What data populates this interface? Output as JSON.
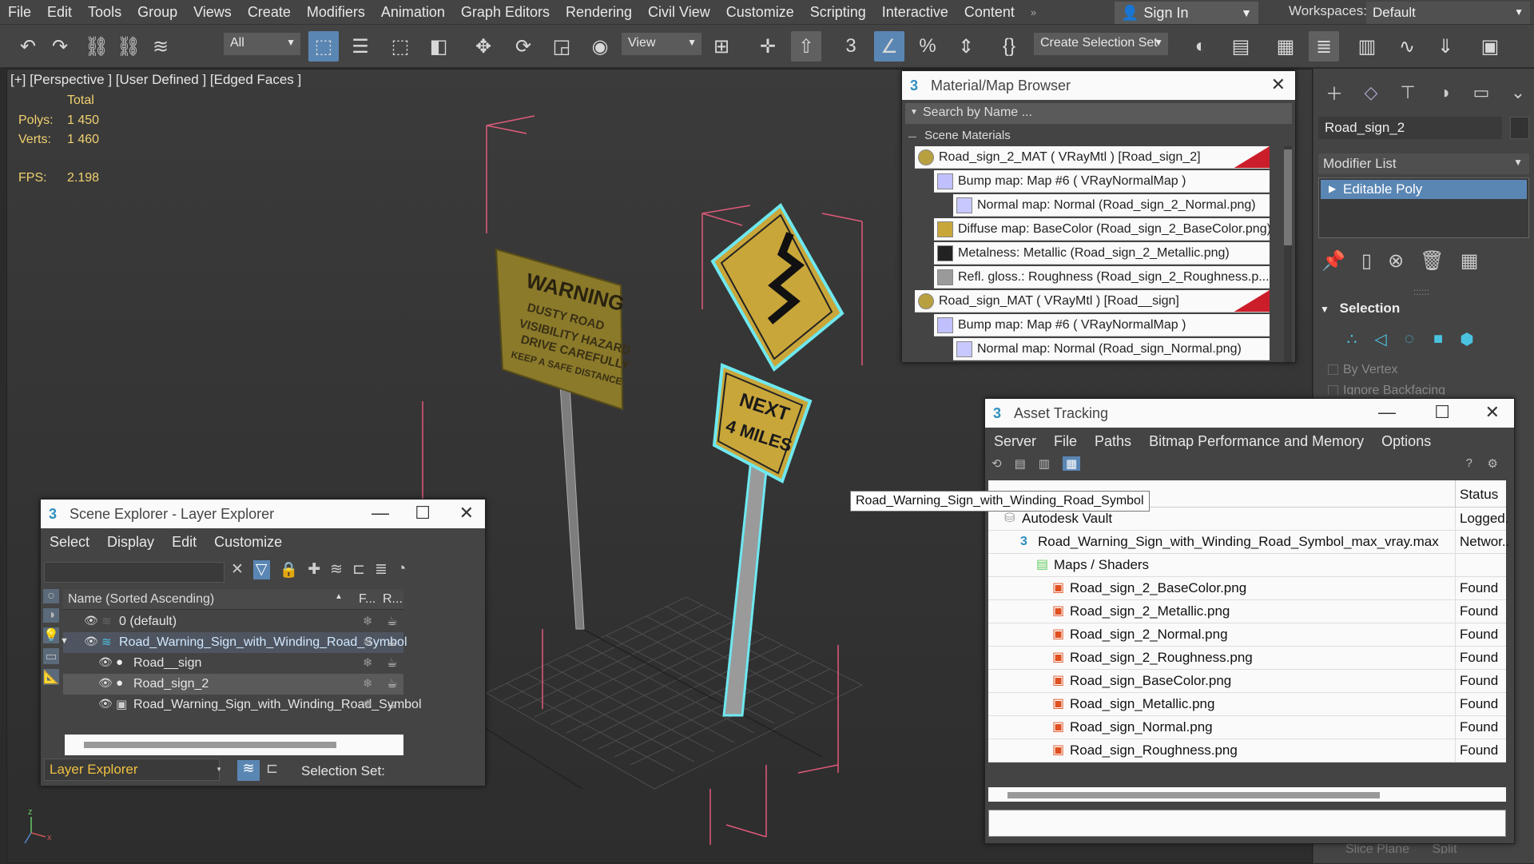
{
  "menu": [
    "File",
    "Edit",
    "Tools",
    "Group",
    "Views",
    "Create",
    "Modifiers",
    "Animation",
    "Graph Editors",
    "Rendering",
    "Civil View",
    "Customize",
    "Scripting",
    "Interactive",
    "Content"
  ],
  "signin": "Sign In",
  "workspaces_label": "Workspaces:",
  "workspace_value": "Default",
  "toolbar": {
    "filter_value": "All",
    "refcoord_value": "View",
    "selection_set": "Create Selection Set"
  },
  "viewport": {
    "label": "[+] [Perspective ] [User Defined ] [Edged Faces ]",
    "total_label": "Total",
    "polys_label": "Polys:",
    "polys_value": "1 450",
    "verts_label": "Verts:",
    "verts_value": "1 460",
    "fps_label": "FPS:",
    "fps_value": "2.198"
  },
  "command_panel": {
    "object_name": "Road_sign_2",
    "modifier_list": "Modifier List",
    "stack_item": "Editable Poly",
    "rollout": "Selection",
    "by_vertex": "By Vertex",
    "ignore_backfacing": "Ignore Backfacing",
    "slice_plane": "Slice Plane",
    "split": "Split"
  },
  "material_browser": {
    "title": "Material/Map Browser",
    "search_placeholder": "Search by Name ...",
    "section": "Scene Materials",
    "rows": [
      {
        "text": "Road_sign_2_MAT  ( VRayMtl )  [Road_sign_2]",
        "indent": 0,
        "swatch": "#b8a040",
        "red": true
      },
      {
        "text": "Bump map: Map #6  ( VRayNormalMap )",
        "indent": 1,
        "swatch": "#c0c0ff",
        "red": false
      },
      {
        "text": "Normal map: Normal (Road_sign_2_Normal.png)",
        "indent": 2,
        "swatch": "#c8c8ff",
        "red": false
      },
      {
        "text": "Diffuse map: BaseColor (Road_sign_2_BaseColor.png)",
        "indent": 1,
        "swatch": "#c9a63a",
        "red": false
      },
      {
        "text": "Metalness: Metallic (Road_sign_2_Metallic.png)",
        "indent": 1,
        "swatch": "#222222",
        "red": false
      },
      {
        "text": "Refl.  gloss.:  Roughness  (Road_sign_2_Roughness.p...",
        "indent": 1,
        "swatch": "#9a9a9a",
        "red": false
      },
      {
        "text": "Road_sign_MAT  ( VRayMtl )  [Road__sign]",
        "indent": 0,
        "swatch": "#b8a040",
        "red": true
      },
      {
        "text": "Bump map: Map #6  ( VRayNormalMap )",
        "indent": 1,
        "swatch": "#c0c0ff",
        "red": false
      },
      {
        "text": "Normal map: Normal (Road_sign_Normal.png)",
        "indent": 2,
        "swatch": "#c8c8ff",
        "red": false
      }
    ]
  },
  "asset_tracking": {
    "title": "Asset Tracking",
    "menu": [
      "Server",
      "File",
      "Paths",
      "Bitmap Performance and Memory",
      "Options"
    ],
    "tooltip": "Road_Warning_Sign_with_Winding_Road_Symbol",
    "status_header": "Status",
    "rows": [
      {
        "name": "Autodesk Vault",
        "status": "Logged.",
        "indent": 0,
        "icon": "vault"
      },
      {
        "name": "Road_Warning_Sign_with_Winding_Road_Symbol_max_vray.max",
        "status": "Networ..",
        "indent": 1,
        "icon": "max"
      },
      {
        "name": "Maps / Shaders",
        "status": "",
        "indent": 2,
        "icon": "folder"
      },
      {
        "name": "Road_sign_2_BaseColor.png",
        "status": "Found",
        "indent": 3,
        "icon": "png"
      },
      {
        "name": "Road_sign_2_Metallic.png",
        "status": "Found",
        "indent": 3,
        "icon": "png"
      },
      {
        "name": "Road_sign_2_Normal.png",
        "status": "Found",
        "indent": 3,
        "icon": "png"
      },
      {
        "name": "Road_sign_2_Roughness.png",
        "status": "Found",
        "indent": 3,
        "icon": "png"
      },
      {
        "name": "Road_sign_BaseColor.png",
        "status": "Found",
        "indent": 3,
        "icon": "png"
      },
      {
        "name": "Road_sign_Metallic.png",
        "status": "Found",
        "indent": 3,
        "icon": "png"
      },
      {
        "name": "Road_sign_Normal.png",
        "status": "Found",
        "indent": 3,
        "icon": "png"
      },
      {
        "name": "Road_sign_Roughness.png",
        "status": "Found",
        "indent": 3,
        "icon": "png"
      }
    ]
  },
  "scene_explorer": {
    "title": "Scene Explorer - Layer Explorer",
    "menu": [
      "Select",
      "Display",
      "Edit",
      "Customize"
    ],
    "col_name": "Name (Sorted Ascending)",
    "col_f": "F...",
    "col_r": "R...",
    "rows": [
      {
        "name": "0 (default)",
        "level": 0,
        "selected": false
      },
      {
        "name": "Road_Warning_Sign_with_Winding_Road_Symbol",
        "level": 0,
        "selected": true
      },
      {
        "name": "Road__sign",
        "level": 1,
        "selected": false
      },
      {
        "name": "Road_sign_2",
        "level": 1,
        "selected": true
      },
      {
        "name": "Road_Warning_Sign_with_Winding_Road_Symbol",
        "level": 1,
        "selected": false
      }
    ],
    "footer_mode": "Layer Explorer",
    "selection_set_label": "Selection Set:"
  },
  "sign_text": {
    "warning_title": "WARNING",
    "warning_lines": [
      "DUSTY ROAD",
      "VISIBILITY HAZARD",
      "DRIVE CAREFULLY",
      "KEEP A SAFE DISTANCE"
    ],
    "next_line1": "NEXT",
    "next_line2": "4 MILES"
  },
  "colors": {
    "accent": "#5a86b4",
    "selection_outline": "#6ee8f0",
    "bbox_pink": "#e05a7a",
    "sign_yellow": "#c9a63a",
    "stats_yellow": "#f0d070"
  }
}
